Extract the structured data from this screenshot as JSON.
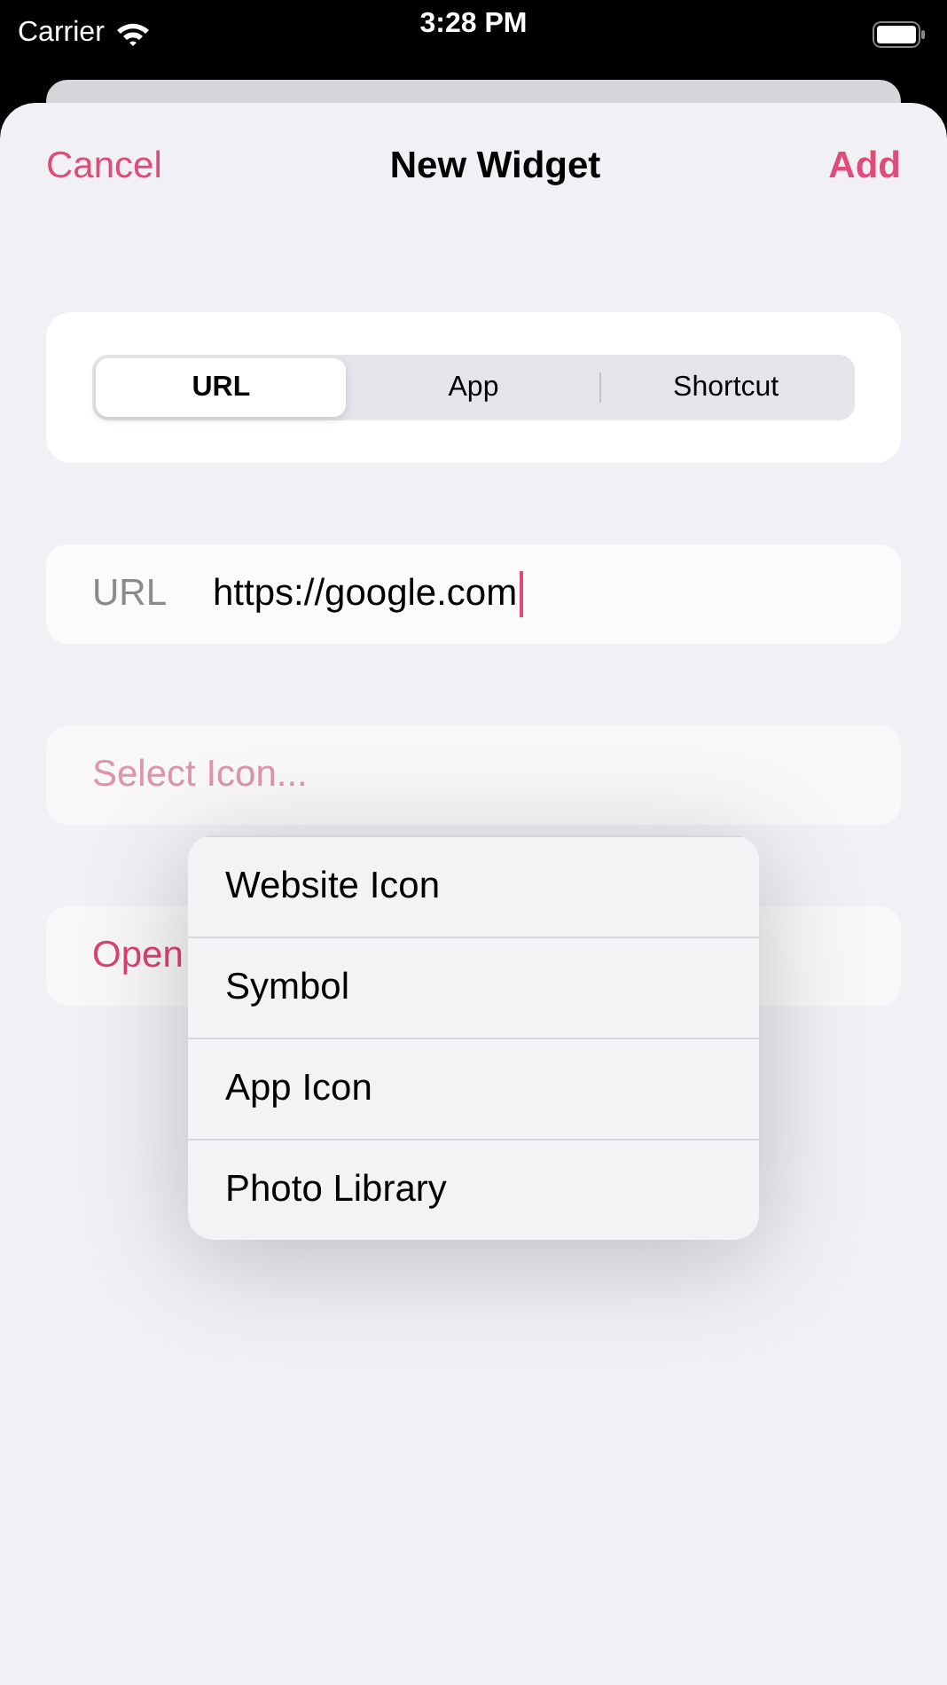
{
  "status_bar": {
    "carrier": "Carrier",
    "time": "3:28 PM"
  },
  "nav": {
    "cancel": "Cancel",
    "title": "New Widget",
    "add": "Add"
  },
  "segments": [
    {
      "label": "URL",
      "selected": true
    },
    {
      "label": "App",
      "selected": false
    },
    {
      "label": "Shortcut",
      "selected": false
    }
  ],
  "url_field": {
    "label": "URL",
    "value": "https://google.com"
  },
  "select_icon": {
    "label": "Select Icon..."
  },
  "open_row": {
    "label": "Open"
  },
  "menu": {
    "items": [
      {
        "label": "Website Icon"
      },
      {
        "label": "Symbol"
      },
      {
        "label": "App Icon"
      },
      {
        "label": "Photo Library"
      }
    ]
  }
}
